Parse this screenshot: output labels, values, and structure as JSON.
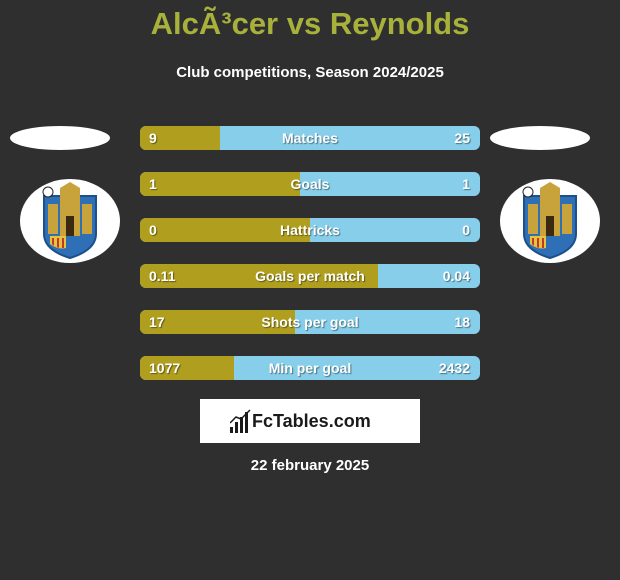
{
  "header": {
    "title": "AlcÃ³cer vs Reynolds",
    "subtitle": "Club competitions, Season 2024/2025"
  },
  "teams": {
    "left": {
      "logo_icon": "club-crest-icon"
    },
    "right": {
      "logo_icon": "club-crest-icon"
    }
  },
  "colors": {
    "left_bar": "#b09f1f",
    "right_bar": "#87ceeb",
    "title": "#a8b13a",
    "background": "#2f2f2f"
  },
  "stats": [
    {
      "label": "Matches",
      "left": "9",
      "right": "25",
      "left_share": 0.235
    },
    {
      "label": "Goals",
      "left": "1",
      "right": "1",
      "left_share": 0.47
    },
    {
      "label": "Hattricks",
      "left": "0",
      "right": "0",
      "left_share": 0.5
    },
    {
      "label": "Goals per match",
      "left": "0.11",
      "right": "0.04",
      "left_share": 0.7
    },
    {
      "label": "Shots per goal",
      "left": "17",
      "right": "18",
      "left_share": 0.455
    },
    {
      "label": "Min per goal",
      "left": "1077",
      "right": "2432",
      "left_share": 0.275
    }
  ],
  "brand": {
    "name": "FcTables.com",
    "icon": "bar-chart-icon"
  },
  "date": "22 february 2025"
}
